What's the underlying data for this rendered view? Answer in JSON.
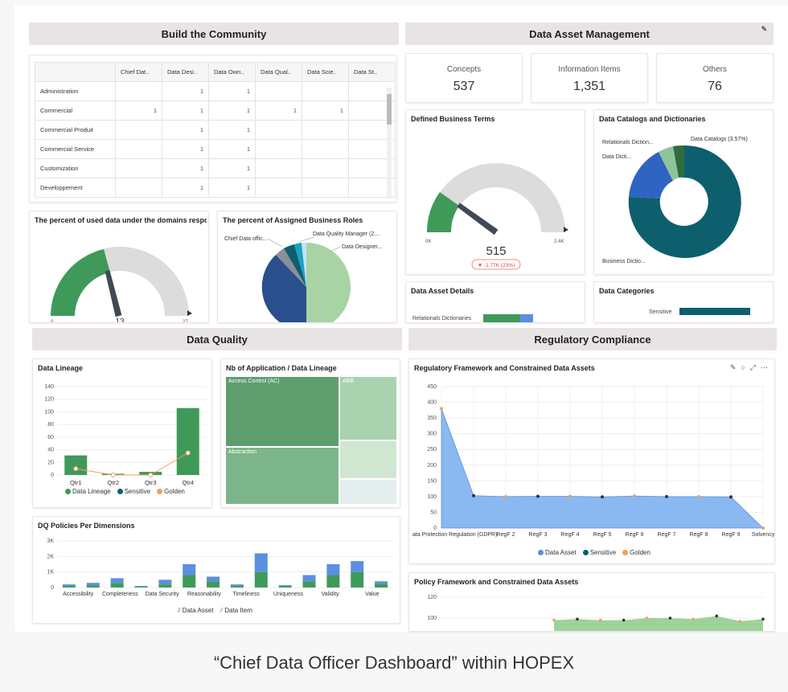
{
  "sections": {
    "build_community": "Build the Community",
    "data_asset_management": "Data Asset Management",
    "data_quality": "Data Quality",
    "regulatory_compliance": "Regulatory Compliance"
  },
  "community_table": {
    "columns": [
      "Chief Dat..",
      "Data Desi..",
      "Data Own..",
      "Data Qual..",
      "Data Scie..",
      "Data St.."
    ],
    "rows": [
      {
        "name": "Administration",
        "cells": [
          "",
          "1",
          "1",
          "",
          "",
          ""
        ]
      },
      {
        "name": "Commercial",
        "cells": [
          "1",
          "1",
          "1",
          "1",
          "1",
          "1"
        ]
      },
      {
        "name": "Commercial Produit",
        "cells": [
          "",
          "1",
          "1",
          "",
          "",
          ""
        ]
      },
      {
        "name": "Commercial Service",
        "cells": [
          "",
          "1",
          "1",
          "",
          "",
          ""
        ]
      },
      {
        "name": "Customization",
        "cells": [
          "",
          "1",
          "1",
          "",
          "",
          ""
        ]
      },
      {
        "name": "Developpement",
        "cells": [
          "",
          "1",
          "1",
          "",
          "",
          ""
        ]
      }
    ]
  },
  "used_data": {
    "title": "The percent of used data under the domains respo...",
    "min": "0",
    "max": "27",
    "value": "13"
  },
  "assigned_roles": {
    "title": "The percent of Assigned Business Roles",
    "labels": [
      "Chief Data offic...",
      "Data Quality Manager (2....",
      "Data Designer..."
    ]
  },
  "kpis": [
    {
      "label": "Concepts",
      "value": "537"
    },
    {
      "label": "Information Items",
      "value": "1,351"
    },
    {
      "label": "Others",
      "value": "76"
    }
  ],
  "business_terms": {
    "title": "Defined Business Terms",
    "min": "0K",
    "max": "2.4K",
    "value": "515",
    "delta": "▼ -1.77K (23%)"
  },
  "catalogs": {
    "title": "Data Catalogs and Dictionaries",
    "labels": [
      "Relationals Diction...",
      "Data Dicti...",
      "Data Catalogs (3.57%)",
      "Business Dictio..."
    ]
  },
  "asset_details": {
    "title": "Data Asset Details",
    "label": "Relationals Dictionaries"
  },
  "categories": {
    "title": "Data Categories",
    "label": "Sensitive"
  },
  "chart_data": [
    {
      "type": "bar",
      "title": "Data Lineage",
      "categories": [
        "Qtr1",
        "Qtr2",
        "Qtr3",
        "Qtr4"
      ],
      "series": [
        {
          "name": "Data Lineage",
          "values": [
            31,
            2,
            5,
            106
          ]
        },
        {
          "name": "Sensitive",
          "values": [
            0,
            0,
            0,
            0
          ]
        },
        {
          "name": "Golden",
          "values": [
            10,
            0,
            0,
            35
          ]
        }
      ],
      "ylim": [
        0,
        140
      ],
      "yticks": [
        "0",
        "20",
        "40",
        "60",
        "80",
        "100",
        "120",
        "140"
      ]
    },
    {
      "type": "heatmap",
      "title": "Nb of Application / Data Lineage",
      "cells": [
        "Access Control (AC)",
        "ABB",
        "Abstraction"
      ]
    },
    {
      "type": "bar",
      "title": "DQ Policies Per Dimensions",
      "categories": [
        "Accessibility",
        "Completeness",
        "Data Security",
        "Reasonability",
        "Timeliness",
        "Uniqueness",
        "Validity",
        "Value"
      ],
      "series": [
        {
          "name": "Data Asset",
          "values": [
            100,
            150,
            300,
            50,
            200,
            800,
            400,
            100,
            1000,
            100,
            400,
            800,
            1000,
            250
          ]
        },
        {
          "name": "Data Item",
          "values": [
            100,
            150,
            300,
            50,
            300,
            700,
            300,
            100,
            1200,
            50,
            400,
            700,
            700,
            150
          ]
        }
      ],
      "ylim": [
        0,
        3000
      ],
      "yticks": [
        "0",
        "1K",
        "2K",
        "3K"
      ]
    },
    {
      "type": "area",
      "title": "Regulatory Framework and Constrained Data Assets",
      "categories": [
        "ata Protection Regulation (GDPR)",
        "",
        "RegF 2",
        "RegF 3",
        "RegF 4",
        "RegF 5",
        "RegF 6",
        "RegF 7",
        "RegF 8",
        "RegF 9",
        "Solvency"
      ],
      "series": [
        {
          "name": "Data Asset",
          "values": [
            380,
            103,
            100,
            101,
            101,
            99,
            102,
            100,
            100,
            99,
            0
          ]
        }
      ],
      "legend": [
        "Data Asset",
        "Sensitive",
        "Golden"
      ],
      "ylim": [
        0,
        450
      ],
      "yticks": [
        "0",
        "50",
        "100",
        "150",
        "200",
        "250",
        "300",
        "350",
        "400",
        "450"
      ]
    },
    {
      "type": "area",
      "title": "Policy Framework and Constrained Data Assets",
      "series": [
        {
          "name": "Data Asset",
          "values": [
            98,
            99,
            98,
            98,
            100,
            100,
            99,
            102,
            97,
            99
          ]
        }
      ],
      "yticks": [
        "100",
        "120"
      ]
    }
  ],
  "legend_lineage": [
    "Data Lineage",
    "Sensitive",
    "Golden"
  ],
  "legend_dq": [
    "Data Asset",
    "Data Item"
  ],
  "legend_reg": [
    "Data Asset",
    "Sensitive",
    "Golden"
  ],
  "caption": "“Chief Data Officer Dashboard” within HOPEX",
  "colors": {
    "green": "#3f9a5a",
    "teal": "#0e5f6e",
    "blue": "#2f64c2",
    "light_blue": "#8ab8f0",
    "orange": "#f0a060",
    "header_bg": "#e8e4e4"
  }
}
